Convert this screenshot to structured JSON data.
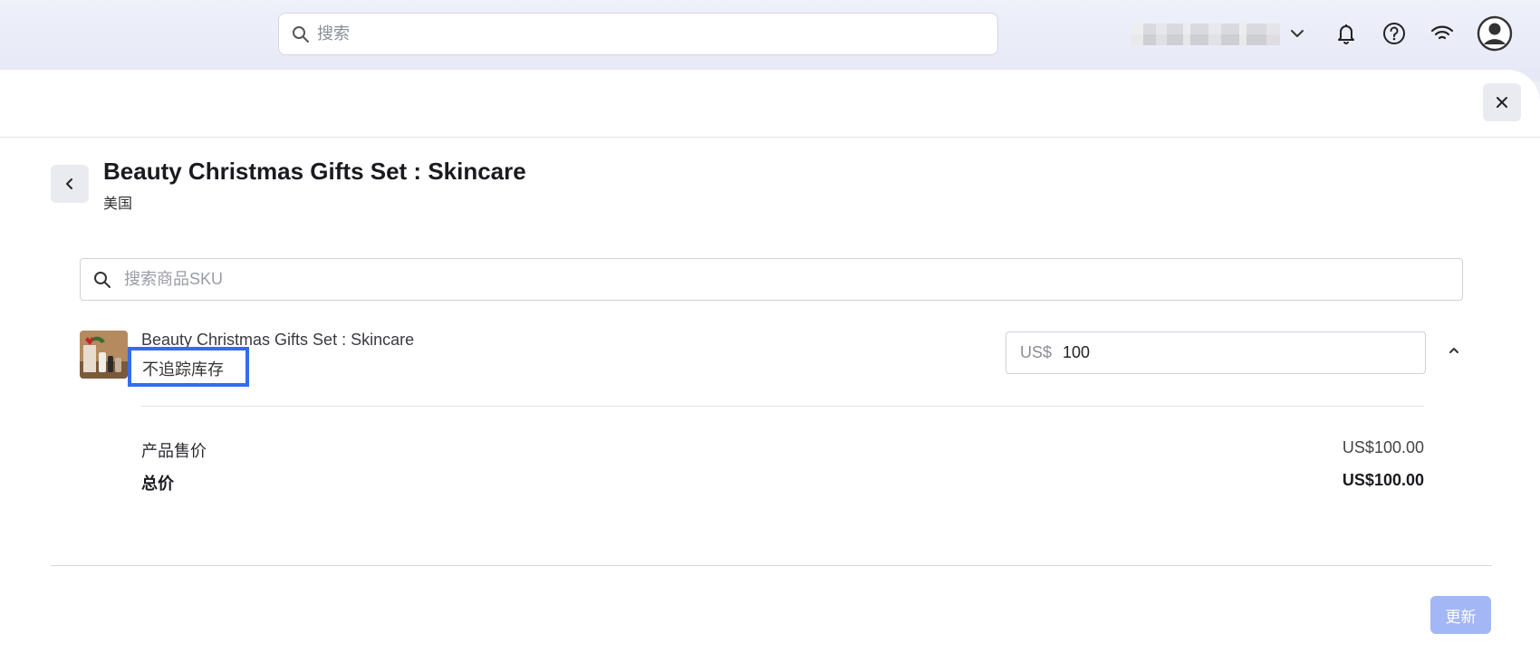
{
  "topbar": {
    "search_placeholder": "搜索",
    "icons": [
      "search-icon",
      "chevron-down-icon",
      "bell-icon",
      "help-icon",
      "wifi-icon",
      "avatar-icon"
    ]
  },
  "panel": {
    "title": "Beauty Christmas Gifts Set : Skincare",
    "subtitle": "美国",
    "sku_search_placeholder": "搜索商品SKU",
    "item": {
      "name": "Beauty Christmas Gifts Set : Skincare",
      "stock_status": "不追踪库存",
      "currency": "US$",
      "price_value": "100"
    },
    "summary": {
      "sale_price_label": "产品售价",
      "sale_price_value": "US$100.00",
      "total_label": "总价",
      "total_value": "US$100.00"
    },
    "update_label": "更新"
  },
  "colors": {
    "accent": "#2f6ef0",
    "update_button": "#a3b6f5",
    "topbar_bg": "#eceef8"
  }
}
